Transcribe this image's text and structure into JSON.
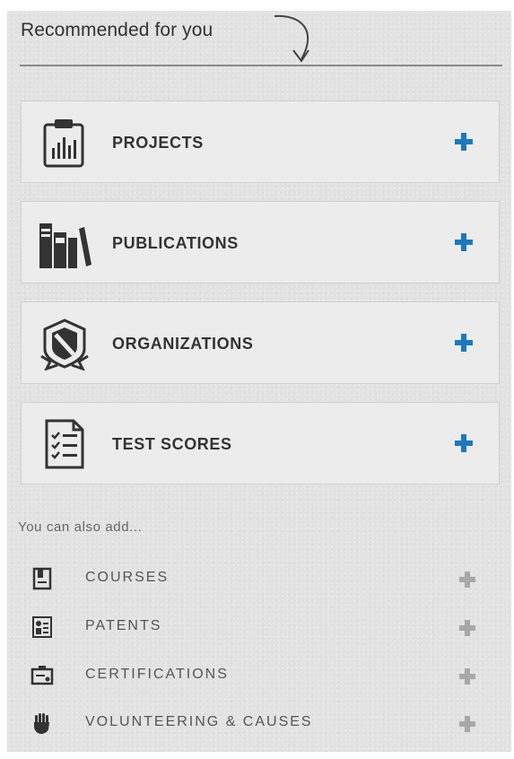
{
  "header": {
    "title": "Recommended for you"
  },
  "sections": [
    {
      "label": "PROJECTS",
      "icon": "clipboard-chart-icon"
    },
    {
      "label": "PUBLICATIONS",
      "icon": "books-icon"
    },
    {
      "label": "ORGANIZATIONS",
      "icon": "shield-badge-icon"
    },
    {
      "label": "TEST SCORES",
      "icon": "checklist-icon"
    }
  ],
  "also": {
    "label": "You can also add...",
    "items": [
      {
        "label": "COURSES",
        "icon": "course-book-icon"
      },
      {
        "label": "PATENTS",
        "icon": "patent-document-icon"
      },
      {
        "label": "CERTIFICATIONS",
        "icon": "certificate-icon"
      },
      {
        "label": "VOLUNTEERING & CAUSES",
        "icon": "raised-hand-icon"
      }
    ]
  },
  "colors": {
    "accent_plus": "#1e78be",
    "muted_plus": "#a8a8a8",
    "panel_bg": "#e2e2e2",
    "card_bg": "#ececec",
    "text_dark": "#333333"
  }
}
